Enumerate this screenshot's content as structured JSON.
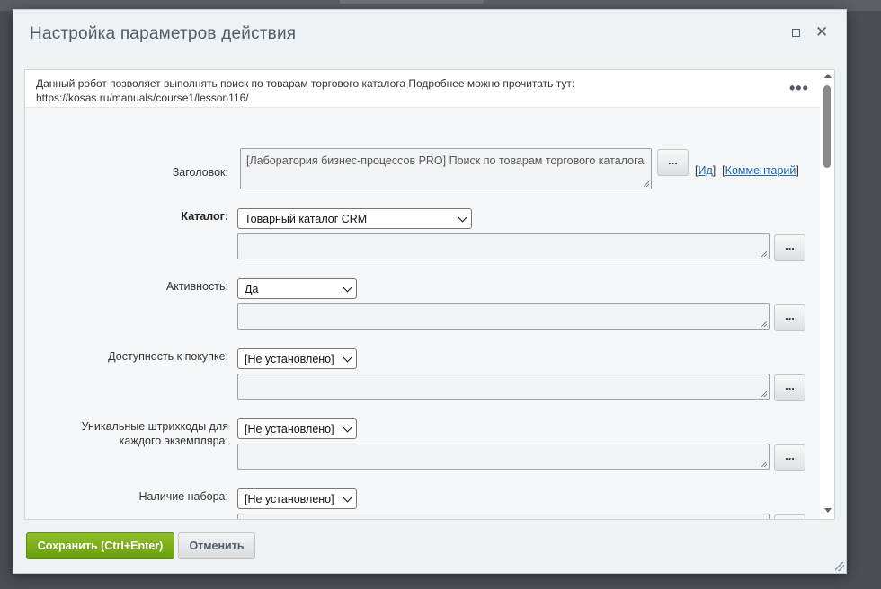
{
  "dialog": {
    "title": "Настройка параметров действия",
    "maximize_icon": "maximize-icon",
    "close_icon": "close-icon",
    "close_glyph": "✕"
  },
  "info": {
    "text_line1": "Данный робот позволяет выполнять поиск по товарам торгового каталога Подробнее можно прочитать тут:",
    "text_line2": "https://kosas.ru/manuals/course1/lesson116/",
    "more_label": "•••"
  },
  "form": {
    "title_field": {
      "label": "Заголовок:",
      "value": "[Лаборатория бизнес-процессов PRO] Поиск по товарам торгового каталога",
      "dots": "...",
      "id_link": "Ид",
      "comment_link": "Комментарий"
    },
    "catalog": {
      "label": "Каталог:",
      "selected": "Товарный каталог CRM",
      "dots": "..."
    },
    "active": {
      "label": "Активность:",
      "selected": "Да",
      "dots": "..."
    },
    "available": {
      "label": "Доступность к покупке:",
      "selected": "[Не установлено]",
      "dots": "..."
    },
    "barcodes": {
      "label_line1": "Уникальные штрихкоды для",
      "label_line2": "каждого экземпляра:",
      "selected": "[Не установлено]",
      "dots": "..."
    },
    "bundle": {
      "label": "Наличие набора:",
      "selected": "[Не установлено]",
      "dots": "..."
    }
  },
  "footer": {
    "save_label": "Сохранить (Ctrl+Enter)",
    "cancel_label": "Отменить"
  }
}
